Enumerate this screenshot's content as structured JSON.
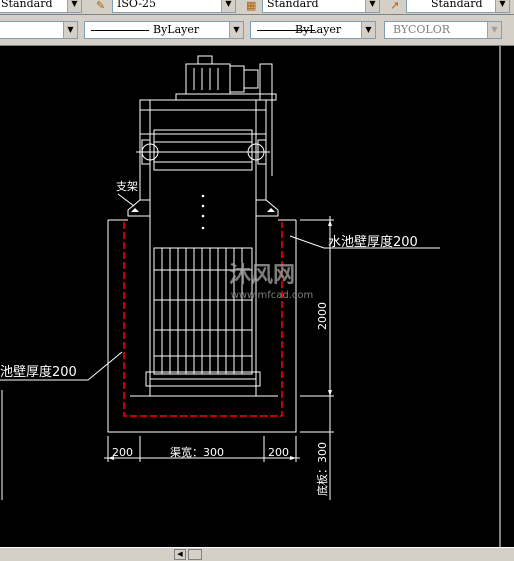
{
  "toolbar_top": {
    "text_style": "Standard",
    "dim_style": "ISO-25",
    "table_style": "Standard",
    "multileader_style": "Standard"
  },
  "toolbar_props": {
    "layer": "",
    "linetype": "ByLayer",
    "lineweight": "ByLayer",
    "plot_style": "BYCOLOR"
  },
  "drawing": {
    "label_bracket": "支架",
    "label_wall_right": "水池壁厚度200",
    "label_wall_left": "池壁厚度200",
    "dim_left": "200",
    "dim_width": "渠宽：300",
    "dim_right": "200",
    "dim_height": "2000",
    "dim_bottom": "底板：300"
  },
  "watermark": {
    "brand": "沐风网",
    "url": "www.mfcad.com"
  },
  "colors": {
    "toolbar_bg": "#d4d0c8",
    "canvas_bg": "#000000",
    "line": "#ffffff",
    "hidden_line": "#ff0000"
  }
}
